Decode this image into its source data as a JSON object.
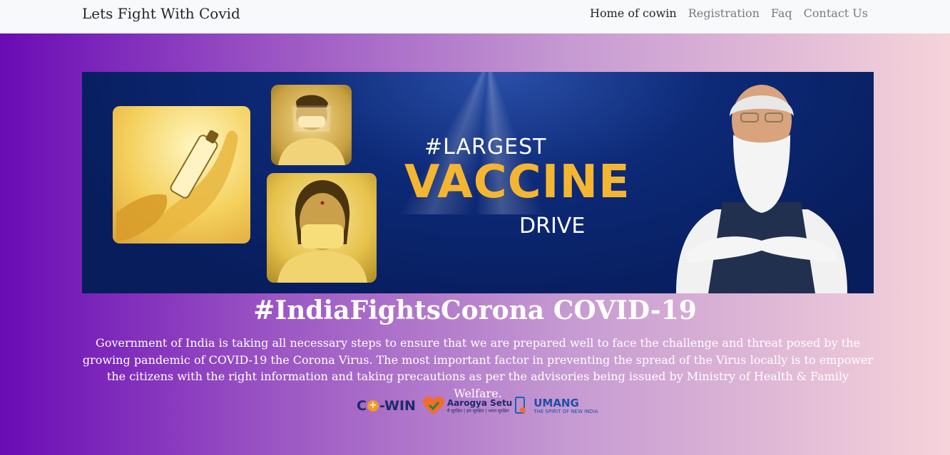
{
  "navbar": {
    "brand": "Lets Fight With Covid",
    "links": [
      {
        "label": "Home of cowin",
        "active": true
      },
      {
        "label": "Registration",
        "active": false
      },
      {
        "label": "Faq",
        "active": false
      },
      {
        "label": "Contact Us",
        "active": false
      }
    ]
  },
  "banner": {
    "slogan_line1": "#LARGEST",
    "slogan_line2": "VACCINE",
    "slogan_line3": "DRIVE"
  },
  "hero": {
    "headline": "#IndiaFightsCorona COVID-19",
    "description": "Government of India is taking all necessary steps to ensure that we are prepared well to face the challenge and threat posed by the growing pandemic of COVID-19 the Corona Virus. The most important factor in preventing the spread of the Virus locally is to empower the citizens with the right information and taking precautions as per the advisories being issued by Ministry of Health & Family Welfare."
  },
  "logos": {
    "cowin": {
      "left": "C",
      "plus": "+",
      "right": "-WIN"
    },
    "aarogya": {
      "name": "Aarogya Setu",
      "sub": "मैं सुरक्षित | हम सुरक्षित | भारत सुरक्षित"
    },
    "umang": {
      "name": "UMANG",
      "tagline": "THE SPIRIT OF NEW INDIA"
    }
  },
  "colors": {
    "gradient_start": "#6a0bb5",
    "gradient_end": "#f6d3da",
    "banner_blue": "#071d5c",
    "vaccine_gold": "#f4b631"
  }
}
